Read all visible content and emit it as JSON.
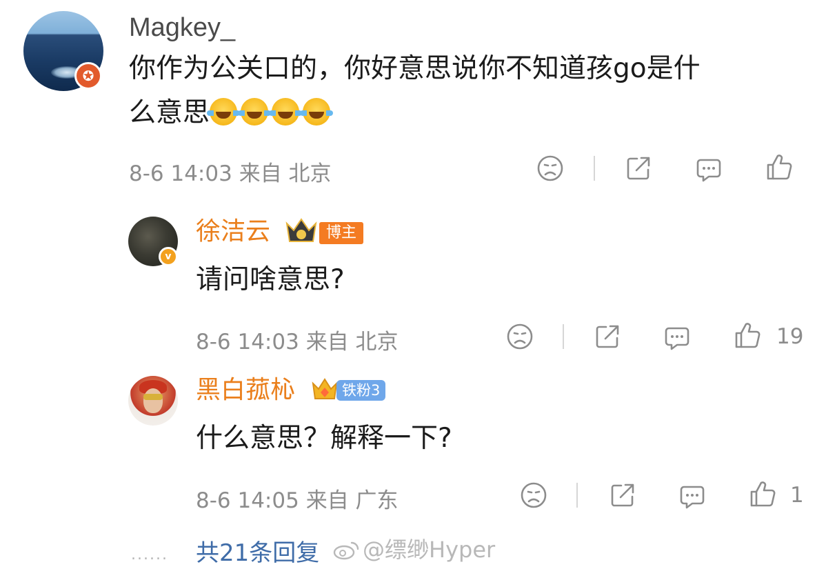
{
  "comments": [
    {
      "username": "Magkey_",
      "text_line1": "你作为公关口的，你好意思说你不知道孩go是什",
      "text_line2": "么意思",
      "emoji": [
        "laugh-cry-emoji",
        "laugh-cry-emoji",
        "laugh-cry-emoji",
        "laugh-cry-emoji"
      ],
      "time": "8-6 14:03",
      "location": "来自 北京",
      "likes": ""
    },
    {
      "username": "徐洁云",
      "badge": "博主",
      "text": "请问啥意思?",
      "time": "8-6 14:03",
      "location": "来自 北京",
      "likes": "19"
    },
    {
      "username": "黑白菰杺",
      "badge": "铁粉3",
      "text": "什么意思？解释一下?",
      "time": "8-6 14:05",
      "location": "来自 广东",
      "likes": "1"
    }
  ],
  "footer": {
    "dots": "......",
    "reply_total": "共21条回复",
    "watermark": "@缥缈Hyper"
  },
  "colors": {
    "username_orange": "#ea7f1c",
    "meta_gray": "#8c8c8c",
    "link_blue": "#3f6ca8",
    "blogger_tag": "#f47b22",
    "fan_tag": "#6fa7ea"
  },
  "icons": [
    "sad-face-icon",
    "share-icon",
    "comment-icon",
    "thumbs-up-icon"
  ]
}
